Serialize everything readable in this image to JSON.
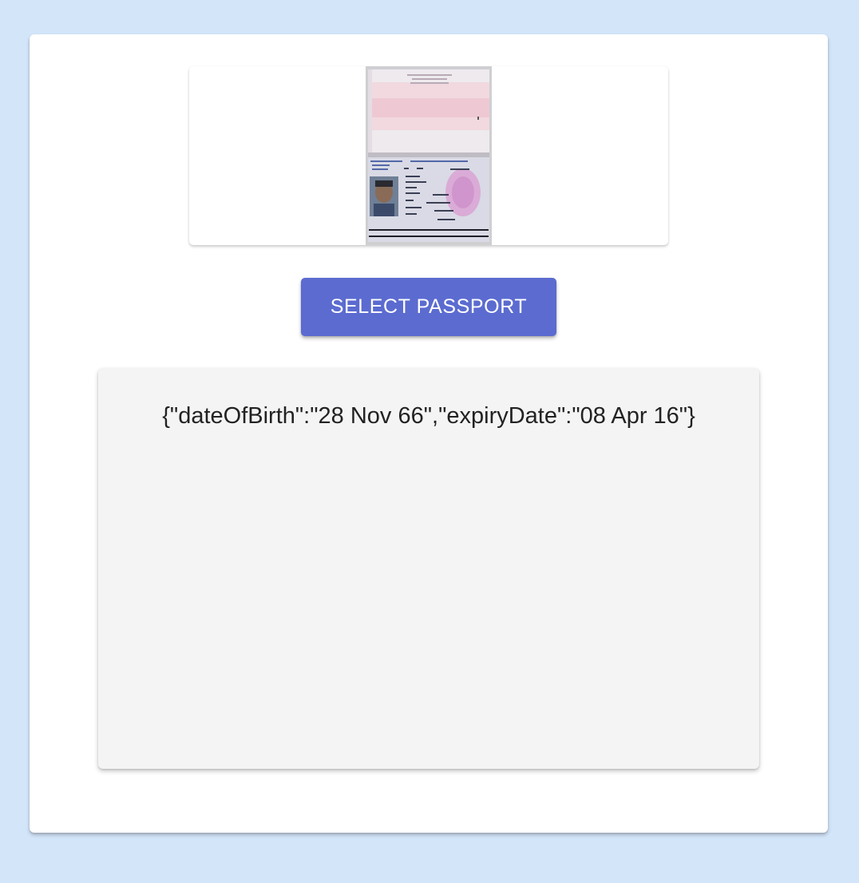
{
  "passport_preview": {
    "alt": "passport scan"
  },
  "actions": {
    "select_passport_label": "Select Passport"
  },
  "result": {
    "text": "{\"dateOfBirth\":\"28 Nov 66\",\"expiryDate\":\"08 Apr 16\"}"
  },
  "colors": {
    "page_background": "#d3e5f9",
    "button": "#5b6bd0",
    "result_background": "#f4f4f4"
  }
}
